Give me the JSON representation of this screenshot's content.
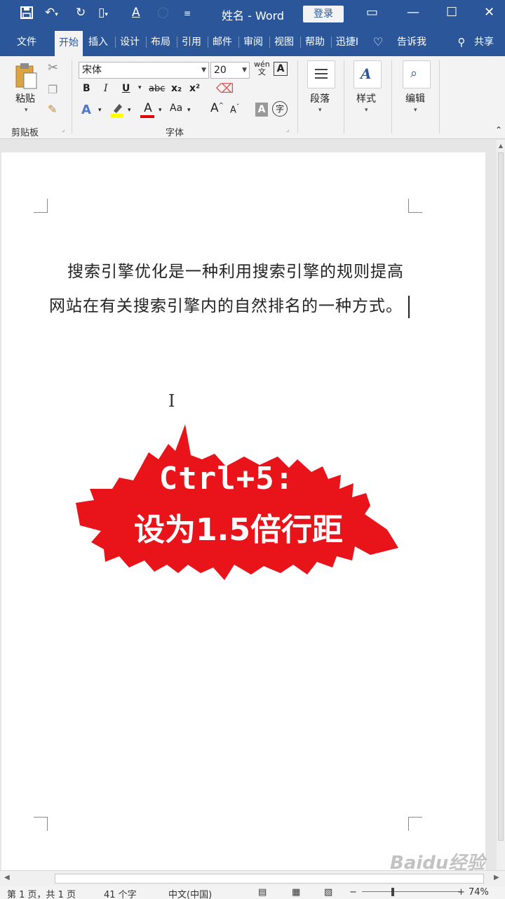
{
  "titlebar": {
    "doc_title": "姓名 - Word",
    "login_button": "登录"
  },
  "tabs": [
    "文件",
    "开始",
    "插入",
    "设计",
    "布局",
    "引用",
    "邮件",
    "审阅",
    "视图",
    "帮助",
    "迅捷I",
    "告诉我",
    "共享"
  ],
  "ribbon": {
    "clipboard": {
      "paste_label": "粘贴",
      "group_label": "剪贴板"
    },
    "font": {
      "font_name": "宋体",
      "font_size": "20",
      "group_label": "字体",
      "bold": "B",
      "italic": "I",
      "underline": "U",
      "strikethrough": "abc",
      "subscript": "x₂",
      "superscript": "x²",
      "change_case": "Aa",
      "phonetic": "wén",
      "char_border": "A",
      "grow_font": "A",
      "shrink_font": "A",
      "char_shading": "A",
      "enclose": "字"
    },
    "paragraph": {
      "label": "段落"
    },
    "styles": {
      "label": "样式"
    },
    "editing": {
      "label": "编辑"
    }
  },
  "document": {
    "paragraph_text": "搜索引擎优化是一种利用搜索引擎的规则提高网站在有关搜索引擎内的自然排名的一种方式。"
  },
  "overlay": {
    "line1": "Ctrl+5:",
    "line2": "设为1.5倍行距",
    "color": "#e8141a"
  },
  "statusbar": {
    "page": "第 1 页，共 1 页",
    "words": "41 个字",
    "language": "中文(中国)",
    "zoom": "74%"
  },
  "watermark": "Baidu经验",
  "colors": {
    "accent": "#2b579a",
    "ribbon_bg": "#f3f3f3"
  }
}
